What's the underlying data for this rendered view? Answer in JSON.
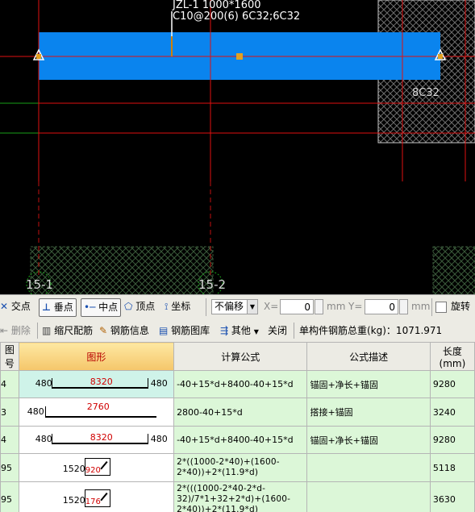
{
  "canvas": {
    "beam_label_line1": "JZL-1 1000*1600",
    "beam_label_line2": "C10@200(6) 6C32;6C32",
    "column_label": "8C32",
    "axis_label_1": "15-1",
    "axis_label_2": "15-2",
    "colors": {
      "background": "#000000",
      "beam": "#0a84ee",
      "axis_line": "#e01010",
      "green_line": "#18a018",
      "hatch": "#6d6d6d"
    }
  },
  "snapbar": {
    "intersection_label": "交点",
    "perpendicular_label": "垂点",
    "midpoint_label": "中点",
    "vertex_label": "顶点",
    "coordinate_label": "坐标",
    "offset_select_value": "不偏移",
    "x_label": "X=",
    "x_value": "0",
    "x_unit": "mm",
    "y_label": "Y=",
    "y_value": "0",
    "y_unit": "mm",
    "rotate_label": "旋转"
  },
  "toolbar": {
    "delete_label": "删除",
    "scale_label": "缩尺配筋",
    "info_label": "钢筋信息",
    "library_label": "钢筋图库",
    "other_label": "其他",
    "close_label": "关闭",
    "total_weight_text": "单构件钢筋总重(kg)：1071.971"
  },
  "table": {
    "headers": [
      "图号",
      "图形",
      "计算公式",
      "公式描述",
      "长度(mm)"
    ],
    "rows": [
      {
        "id": "4",
        "figure": {
          "left": "480",
          "middle": "8320",
          "right": "480"
        },
        "formula": "-40+15*d+8400-40+15*d",
        "description": "锚固+净长+锚固",
        "length": "9280"
      },
      {
        "id": "3",
        "figure": {
          "left": "480",
          "middle": "2760"
        },
        "formula": "2800-40+15*d",
        "description": "搭接+锚固",
        "length": "3240"
      },
      {
        "id": "4",
        "figure": {
          "left": "480",
          "middle": "8320",
          "right": "480"
        },
        "formula": "-40+15*d+8400-40+15*d",
        "description": "锚固+净长+锚固",
        "length": "9280"
      },
      {
        "id": "95",
        "figure": {
          "outside": "1520",
          "inside": "920"
        },
        "formula": "2*((1000-2*40)+(1600-2*40))+2*(11.9*d)",
        "description": "",
        "length": "5118"
      },
      {
        "id": "95",
        "figure": {
          "outside": "1520",
          "inside": "176"
        },
        "formula": "2*(((1000-2*40-2*d-32)/7*1+32+2*d)+(1600-2*40))+2*(11.9*d)",
        "description": "",
        "length": "3630"
      }
    ]
  }
}
